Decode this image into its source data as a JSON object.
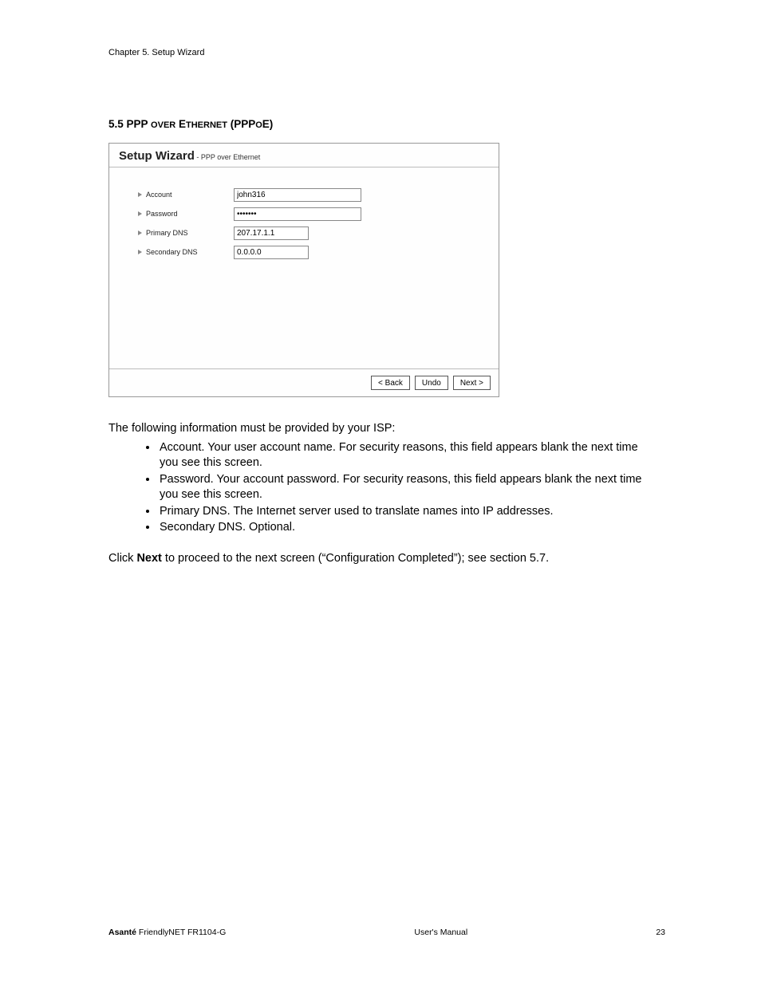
{
  "chapter_header": "Chapter 5. Setup Wizard",
  "section_heading_prefix": "5.5 PPP ",
  "section_heading_over": "OVER",
  "section_heading_mid": " E",
  "section_heading_thernet": "THERNET",
  "section_heading_suffix": " (PPP",
  "section_heading_o": "O",
  "section_heading_e": "E)",
  "wizard": {
    "title_main": "Setup Wizard",
    "title_sep": " - ",
    "title_sub": "PPP over Ethernet",
    "fields": {
      "account_label": "Account",
      "account_value": "john316",
      "password_label": "Password",
      "password_value": "•••••••",
      "primary_dns_label": "Primary DNS",
      "primary_dns_value": "207.17.1.1",
      "secondary_dns_label": "Secondary DNS",
      "secondary_dns_value": "0.0.0.0"
    },
    "buttons": {
      "back": "< Back",
      "undo": "Undo",
      "next": "Next >"
    }
  },
  "intro_line": "The following information must be provided by your ISP:",
  "bullets": [
    "Account. Your user account name. For security reasons, this field appears blank the next time you see this screen.",
    "Password. Your account password. For security reasons, this field appears blank the next time you see this screen.",
    "Primary DNS. The Internet server used to translate names into IP addresses.",
    "Secondary DNS. Optional."
  ],
  "next_line_before": "Click ",
  "next_line_bold": "Next",
  "next_line_after": " to proceed to the next screen (“Configuration Completed”); see section 5.7.",
  "footer": {
    "brand_bold": "Asanté",
    "brand_rest": " FriendlyNET FR1104-G",
    "center": "User's Manual",
    "page": "23"
  }
}
